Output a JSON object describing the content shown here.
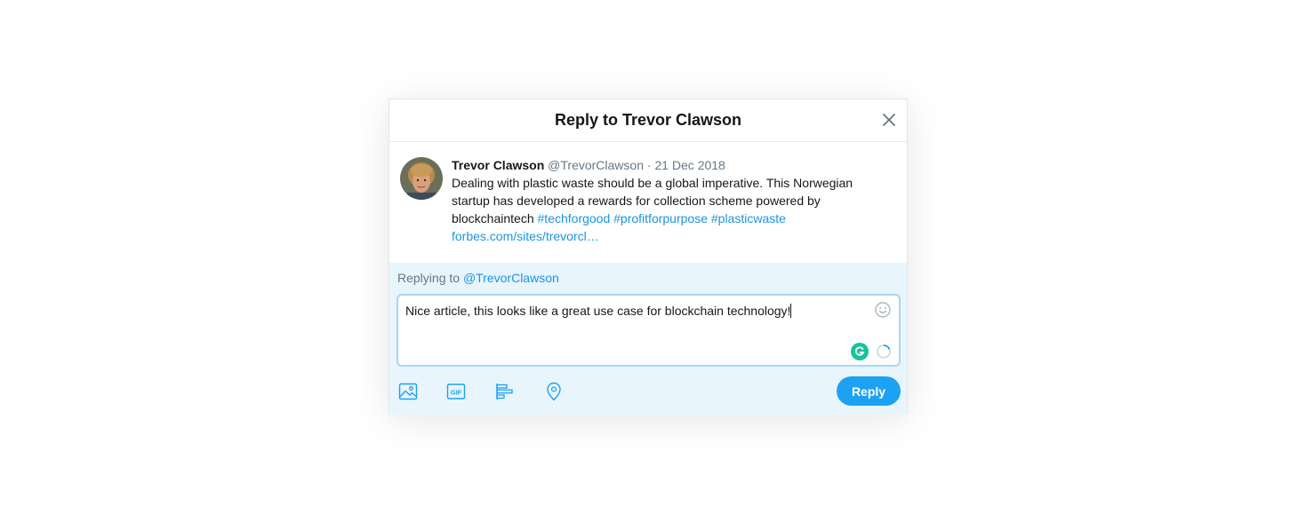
{
  "modal": {
    "title": "Reply to Trevor Clawson",
    "close_icon": "close-icon"
  },
  "tweet": {
    "author_name": "Trevor Clawson",
    "author_handle": "@TrevorClawson",
    "separator": "·",
    "date": "21 Dec 2018",
    "text": "Dealing with plastic waste should be a global imperative. This Norwegian startup has developed a rewards for collection scheme powered by blockchaintech",
    "hashtags": [
      "#techforgood",
      "#profitforpurpose",
      "#plasticwaste"
    ],
    "link": "forbes.com/sites/trevorcl…"
  },
  "compose": {
    "replying_prefix": "Replying to",
    "replying_to": "@TrevorClawson",
    "text": "Nice article, this looks like a great use case for blockchain technology!",
    "reply_label": "Reply"
  },
  "toolbar": {
    "icons": [
      "image-icon",
      "gif-icon",
      "poll-icon",
      "location-icon"
    ],
    "gif_label": "GIF"
  },
  "colors": {
    "brand": "#1da1f2",
    "link": "#1b95e0",
    "compose_bg": "#e8f5fd",
    "grammarly": "#15c39a"
  }
}
